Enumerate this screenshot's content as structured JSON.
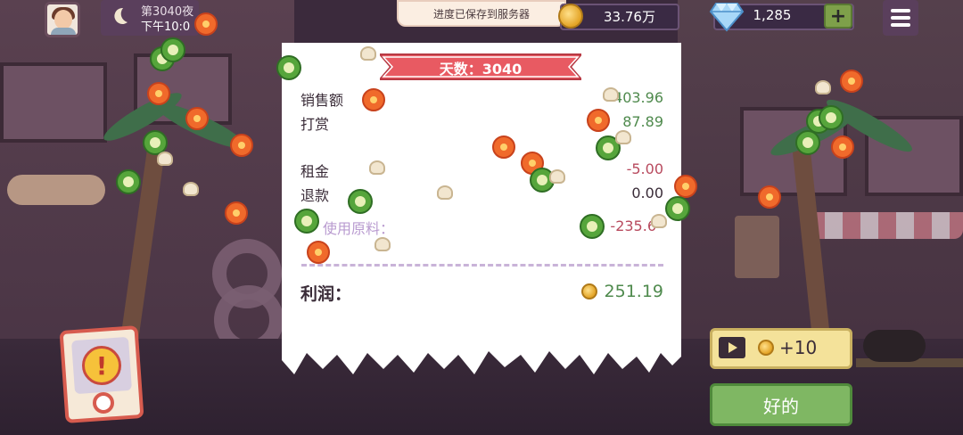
{
  "top_bar": {
    "day_label": "第3040夜",
    "time_label": "下午10:0",
    "save_toast": "进度已保存到服务器",
    "coins": "33.76万",
    "gems": "1,285",
    "add_gems_label": "+"
  },
  "receipt": {
    "banner": "天数：3040",
    "rows": [
      {
        "label": "销售额",
        "value": "403.96"
      },
      {
        "label": "打赏",
        "value": "87.89"
      },
      {
        "label": "租金",
        "value": "-5.00"
      },
      {
        "label": "退款",
        "value": "0.00"
      },
      {
        "label": "使用原料：",
        "value": "-235.6"
      }
    ],
    "profit_label": "利润：",
    "profit_value": "251.19"
  },
  "actions": {
    "ad_reward": "+10",
    "ok_label": "好的"
  },
  "colors": {
    "positive": "#4f8a4d",
    "negative": "#b84a5e",
    "banner": "#e85a62",
    "ok_button": "#7fb763",
    "ad_button": "#f4e29a"
  },
  "icons": [
    "moon-icon",
    "coin-icon",
    "gem-icon",
    "plus-icon",
    "menu-icon",
    "play-icon",
    "alert-icon"
  ]
}
